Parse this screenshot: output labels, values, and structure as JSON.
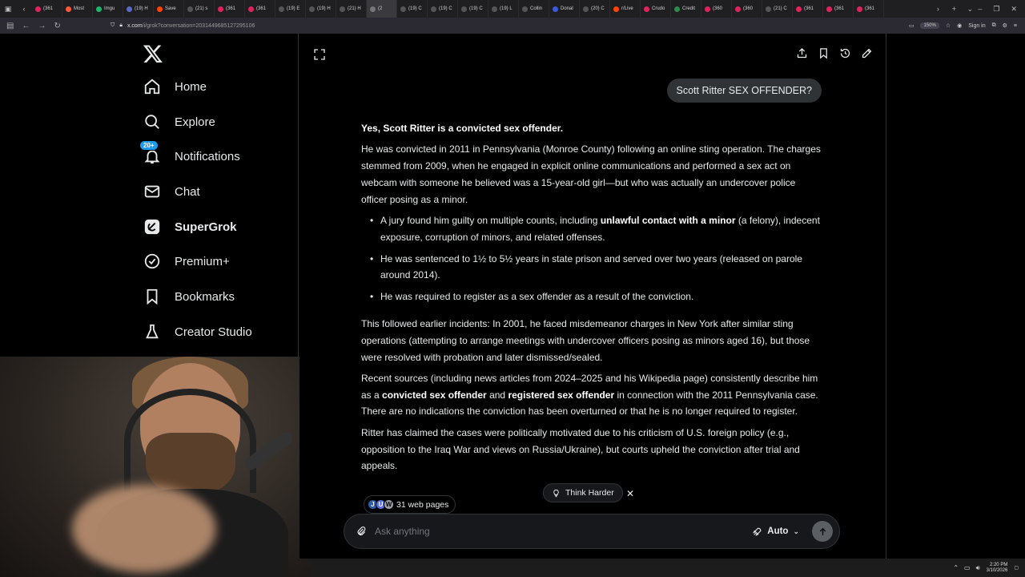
{
  "browser": {
    "tabs": [
      {
        "label": "(361",
        "color": "#e0245e"
      },
      {
        "label": "Most",
        "color": "#ff5a36"
      },
      {
        "label": "Imgu",
        "color": "#1bb76e"
      },
      {
        "label": "(19) H",
        "color": "#5b6bc0"
      },
      {
        "label": "Save",
        "color": "#ff4500"
      },
      {
        "label": "(21) s",
        "color": "#555"
      },
      {
        "label": "(361",
        "color": "#e0245e"
      },
      {
        "label": "(361",
        "color": "#e0245e"
      },
      {
        "label": "(19) E",
        "color": "#555"
      },
      {
        "label": "(19) H",
        "color": "#555"
      },
      {
        "label": "(21) H",
        "color": "#555"
      },
      {
        "label": "(2",
        "color": "#777"
      },
      {
        "label": "(19) C",
        "color": "#555"
      },
      {
        "label": "(19) C",
        "color": "#555"
      },
      {
        "label": "(19) C",
        "color": "#555"
      },
      {
        "label": "(19) L",
        "color": "#555"
      },
      {
        "label": "Collin",
        "color": "#555"
      },
      {
        "label": "Donal",
        "color": "#3b5bdb"
      },
      {
        "label": "(20) C",
        "color": "#555"
      },
      {
        "label": "r/Live",
        "color": "#ff4500"
      },
      {
        "label": "Crudo",
        "color": "#e0245e"
      },
      {
        "label": "Credit",
        "color": "#2d8a4e"
      },
      {
        "label": "(360",
        "color": "#e0245e"
      },
      {
        "label": "(360",
        "color": "#e0245e"
      },
      {
        "label": "(21) C",
        "color": "#555"
      },
      {
        "label": "(361",
        "color": "#e0245e"
      },
      {
        "label": "(361",
        "color": "#e0245e"
      },
      {
        "label": "(361",
        "color": "#e0245e"
      }
    ],
    "active_tab_index": 11,
    "url_host": "x.com",
    "url_path": "/i/grok?conversation=2031449685127295106",
    "zoom": "150%",
    "sign_in": "Sign in"
  },
  "sidebar": {
    "items": [
      {
        "label": "Home",
        "icon": "home-icon"
      },
      {
        "label": "Explore",
        "icon": "search-icon"
      },
      {
        "label": "Notifications",
        "icon": "bell-icon",
        "badge": "20+"
      },
      {
        "label": "Chat",
        "icon": "mail-icon"
      },
      {
        "label": "SuperGrok",
        "icon": "grok-icon"
      },
      {
        "label": "Premium+",
        "icon": "verified-icon"
      },
      {
        "label": "Bookmarks",
        "icon": "bookmark-icon"
      },
      {
        "label": "Creator Studio",
        "icon": "flask-icon"
      }
    ]
  },
  "chat": {
    "user_message": "Scott Ritter SEX OFFENDER?",
    "answer": {
      "lead": "Yes, Scott Ritter is a convicted sex offender.",
      "p1": "He was convicted in 2011 in Pennsylvania (Monroe County) following an online sting operation. The charges stemmed from 2009, when he engaged in explicit online communications and performed a sex act on webcam with someone he believed was a 15-year-old girl—but who was actually an undercover police officer posing as a minor.",
      "b1_pre": "A jury found him guilty on multiple counts, including ",
      "b1_bold": "unlawful contact with a minor",
      "b1_post": " (a felony), indecent exposure, corruption of minors, and related offenses.",
      "b2": "He was sentenced to 1½ to 5½ years in state prison and served over two years (released on parole around 2014).",
      "b3": "He was required to register as a sex offender as a result of the conviction.",
      "p2": "This followed earlier incidents: In 2001, he faced misdemeanor charges in New York after similar sting operations (attempting to arrange meetings with undercover officers posing as minors aged 16), but those were resolved with probation and later dismissed/sealed.",
      "p3_a": "Recent sources (including news articles from 2024–2025 and his Wikipedia page) consistently describe him as a ",
      "p3_b": "convicted sex offender",
      "p3_c": " and ",
      "p3_d": "registered sex offender",
      "p3_e": " in connection with the 2011 Pennsylvania case. There are no indications the conviction has been overturned or that he is no longer required to register.",
      "p4": "Ritter has claimed the cases were politically motivated due to his criticism of U.S. foreign policy (e.g., opposition to the Iraq War and views on Russia/Ukraine), but courts upheld the conviction after trial and appeals."
    },
    "think_harder": "Think Harder",
    "web_pages": "31 web pages",
    "web_favicons": [
      "J",
      "U",
      "W"
    ],
    "ask_placeholder": "Ask anything",
    "mode": "Auto"
  },
  "taskbar": {
    "time": "2:20 PM",
    "date": "3/10/2026"
  },
  "colors": {
    "background": "#000000",
    "text": "#e7e9ea",
    "accent": "#1d9bf0",
    "bubble": "#2f3336"
  }
}
